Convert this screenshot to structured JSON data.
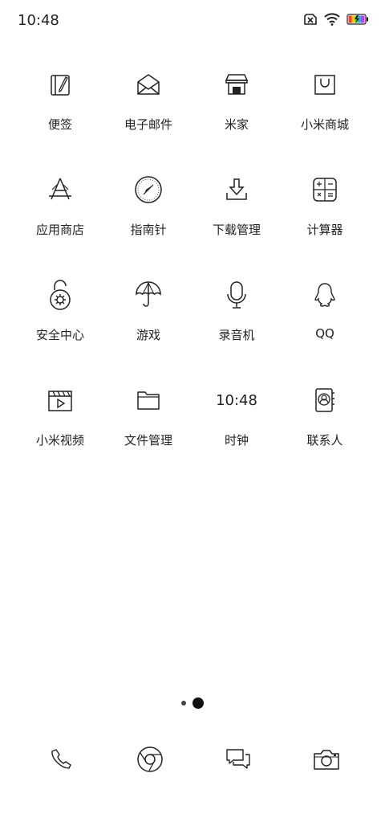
{
  "status_bar": {
    "time": "10:48"
  },
  "apps": [
    {
      "label": "便签",
      "icon": "notes-icon"
    },
    {
      "label": "电子邮件",
      "icon": "mail-icon"
    },
    {
      "label": "米家",
      "icon": "store-icon"
    },
    {
      "label": "小米商城",
      "icon": "shopping-bag-icon"
    },
    {
      "label": "应用商店",
      "icon": "app-store-icon"
    },
    {
      "label": "指南针",
      "icon": "compass-icon"
    },
    {
      "label": "下载管理",
      "icon": "download-icon"
    },
    {
      "label": "计算器",
      "icon": "calculator-icon"
    },
    {
      "label": "安全中心",
      "icon": "security-lock-icon"
    },
    {
      "label": "游戏",
      "icon": "umbrella-icon"
    },
    {
      "label": "录音机",
      "icon": "microphone-icon"
    },
    {
      "label": "QQ",
      "icon": "penguin-icon"
    },
    {
      "label": "小米视频",
      "icon": "video-clapper-icon"
    },
    {
      "label": "文件管理",
      "icon": "folder-icon"
    },
    {
      "label": "时钟",
      "icon": "clock-text-icon",
      "display": "10:48"
    },
    {
      "label": "联系人",
      "icon": "contacts-icon"
    }
  ],
  "page_indicator": {
    "current_page": 2,
    "total_pages": 2
  },
  "dock": [
    {
      "icon": "phone-icon"
    },
    {
      "icon": "browser-icon"
    },
    {
      "icon": "messages-icon"
    },
    {
      "icon": "camera-icon"
    }
  ]
}
